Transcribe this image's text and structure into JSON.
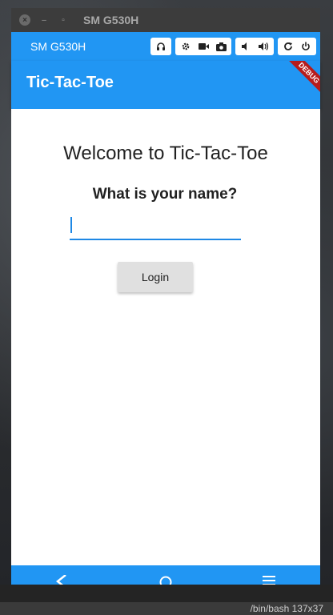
{
  "window": {
    "title": "SM G530H",
    "close_glyph": "×",
    "min_glyph": "–",
    "max_glyph": "▫"
  },
  "emulator": {
    "device_name": "SM G530H",
    "tool_icons": [
      "headphones-icon",
      "settings-icon",
      "video-camera-icon",
      "camera-icon",
      "volume-down-icon",
      "volume-up-icon",
      "rotate-icon",
      "power-icon"
    ]
  },
  "app": {
    "title": "Tic-Tac-Toe",
    "debug_banner": "DEBUG",
    "welcome": "Welcome to Tic-Tac-Toe",
    "prompt": "What is your name?",
    "name_value": "",
    "login_label": "Login",
    "colors": {
      "primary": "#2196f3",
      "button": "#e0e0e0",
      "underline": "#1e88e5"
    }
  },
  "nav": {
    "icons": [
      "back-icon",
      "home-icon",
      "menu-icon"
    ]
  },
  "terminal": {
    "status": "/bin/bash 137x37"
  }
}
